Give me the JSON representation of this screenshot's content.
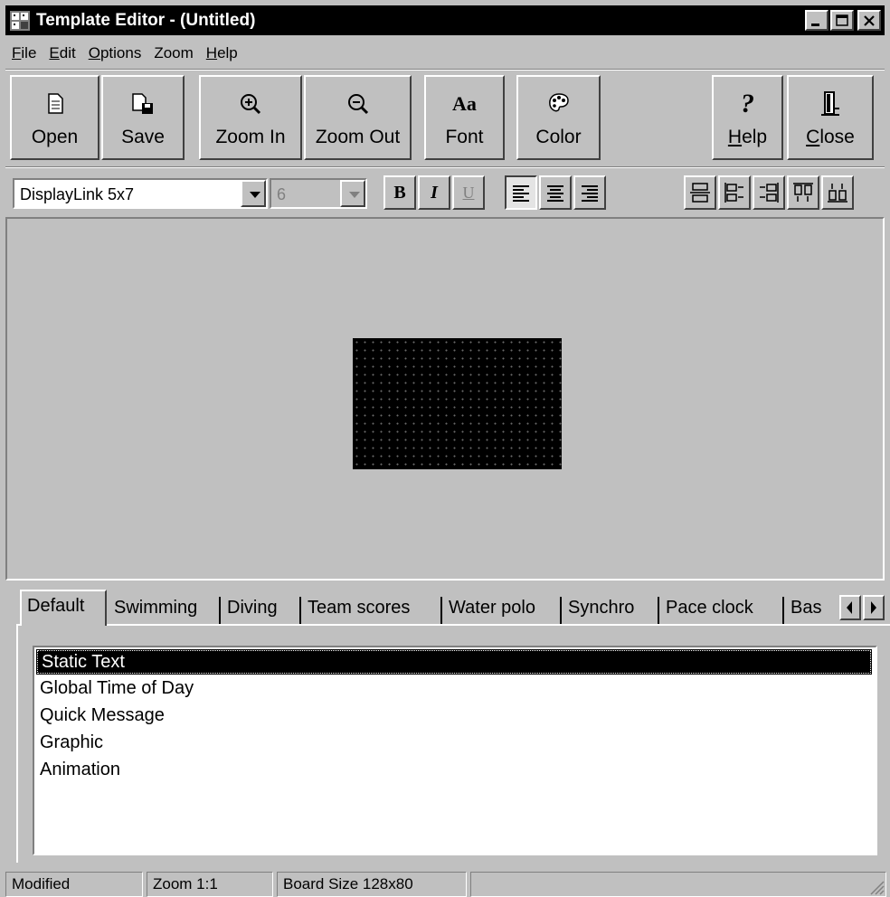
{
  "window": {
    "title": "Template Editor - (Untitled)"
  },
  "menu": [
    {
      "pre": "",
      "u": "F",
      "post": "ile"
    },
    {
      "pre": "",
      "u": "E",
      "post": "dit"
    },
    {
      "pre": "",
      "u": "O",
      "post": "ptions"
    },
    {
      "pre": "Zoom",
      "u": "",
      "post": ""
    },
    {
      "pre": "",
      "u": "H",
      "post": "elp"
    }
  ],
  "toolbar": {
    "open": "Open",
    "save": "Save",
    "zoom_in": "Zoom In",
    "zoom_out": "Zoom Out",
    "font": "Font",
    "font_icon": "Aa",
    "color": "Color",
    "help_u": "H",
    "help_rest": "elp",
    "close_u": "C",
    "close_rest": "lose"
  },
  "format": {
    "font_name": "DisplayLink 5x7",
    "font_size": "6",
    "bold": "B",
    "italic": "I",
    "underline": "U"
  },
  "tabs": [
    "Default",
    "Swimming",
    "Diving",
    "Team scores",
    "Water polo",
    "Synchro",
    "Pace clock",
    "Bas"
  ],
  "list": {
    "items": [
      "Static Text",
      "Global Time of Day",
      "Quick Message",
      "Graphic",
      "Animation"
    ],
    "selected_index": 0
  },
  "status": {
    "state": "Modified",
    "zoom": "Zoom 1:1",
    "board": "Board Size 128x80"
  },
  "colors": {
    "title_bar": "#000000",
    "face": "#c0c0c0",
    "board": "#000000"
  }
}
